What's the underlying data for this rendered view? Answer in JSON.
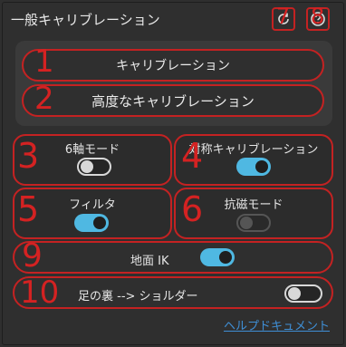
{
  "header": {
    "title": "一般キャリブレーション",
    "refresh_icon": "refresh-icon",
    "help_icon": "help-circle-icon",
    "badges": {
      "refresh": "7",
      "help": "8"
    }
  },
  "calibration_group": {
    "calibrate_label": "キャリブレーション",
    "advanced_label": "高度なキャリブレーション",
    "badges": {
      "calibrate": "1",
      "advanced": "2"
    }
  },
  "options": {
    "six_axis": {
      "label": "6軸モード",
      "state": "off",
      "badge": "3"
    },
    "symmetric": {
      "label": "対称キャリブレーション",
      "state": "on",
      "badge": "4"
    },
    "filter": {
      "label": "フィルタ",
      "state": "on",
      "badge": "5"
    },
    "anti_magnetic": {
      "label": "抗磁モード",
      "state": "disabled",
      "badge": "6"
    },
    "ground_ik": {
      "label": "地面 IK",
      "state": "on",
      "badge": "9"
    },
    "foot_shoulder": {
      "label": "足の裏 --> ショルダー",
      "state": "off",
      "badge": "10"
    }
  },
  "footer": {
    "help_link": "ヘルプドキュメント"
  },
  "colors": {
    "accent": "#4fb8e2",
    "annotation": "#c42222",
    "link": "#3f8fd6"
  }
}
